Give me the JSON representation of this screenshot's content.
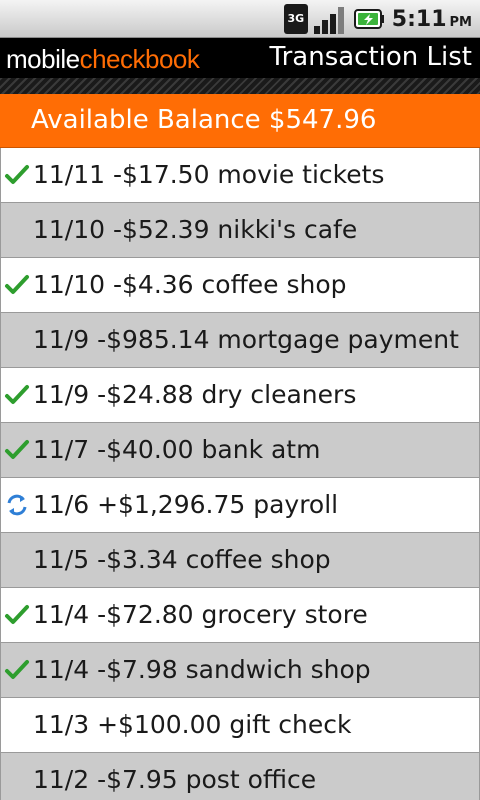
{
  "status_bar": {
    "network_badge_top": "3G",
    "network_badge_bottom": "",
    "network_icon": "3g-network-icon",
    "signal_icon": "signal-strength-icon",
    "battery_icon": "battery-charging-icon",
    "time": "5:11",
    "ampm": "PM"
  },
  "header": {
    "logo_part1": "mobile",
    "logo_part2": "checkbook",
    "title": "Transaction List"
  },
  "balance": {
    "label": "Available Balance",
    "amount": "$547.96"
  },
  "colors": {
    "accent": "#ff6d05",
    "cleared_check": "#2e9e2e",
    "pending_sync": "#2f7fd6",
    "row_alt": "#cbcbcb"
  },
  "transactions": [
    {
      "text": "11/11 -$17.50 movie tickets",
      "status": "cleared",
      "status_icon": "checkmark-icon"
    },
    {
      "text": "11/10 -$52.39 nikki's cafe",
      "status": "none",
      "status_icon": ""
    },
    {
      "text": "11/10 -$4.36 coffee shop",
      "status": "cleared",
      "status_icon": "checkmark-icon"
    },
    {
      "text": "11/9 -$985.14 mortgage payment",
      "status": "none",
      "status_icon": ""
    },
    {
      "text": "11/9 -$24.88 dry cleaners",
      "status": "cleared",
      "status_icon": "checkmark-icon"
    },
    {
      "text": "11/7 -$40.00 bank atm",
      "status": "cleared",
      "status_icon": "checkmark-icon"
    },
    {
      "text": "11/6 +$1,296.75 payroll",
      "status": "pending",
      "status_icon": "sync-icon"
    },
    {
      "text": "11/5 -$3.34 coffee shop",
      "status": "none",
      "status_icon": ""
    },
    {
      "text": "11/4 -$72.80 grocery store",
      "status": "cleared",
      "status_icon": "checkmark-icon"
    },
    {
      "text": "11/4 -$7.98 sandwich shop",
      "status": "cleared",
      "status_icon": "checkmark-icon"
    },
    {
      "text": "11/3 +$100.00 gift check",
      "status": "none",
      "status_icon": ""
    },
    {
      "text": "11/2 -$7.95 post office",
      "status": "none",
      "status_icon": ""
    }
  ]
}
